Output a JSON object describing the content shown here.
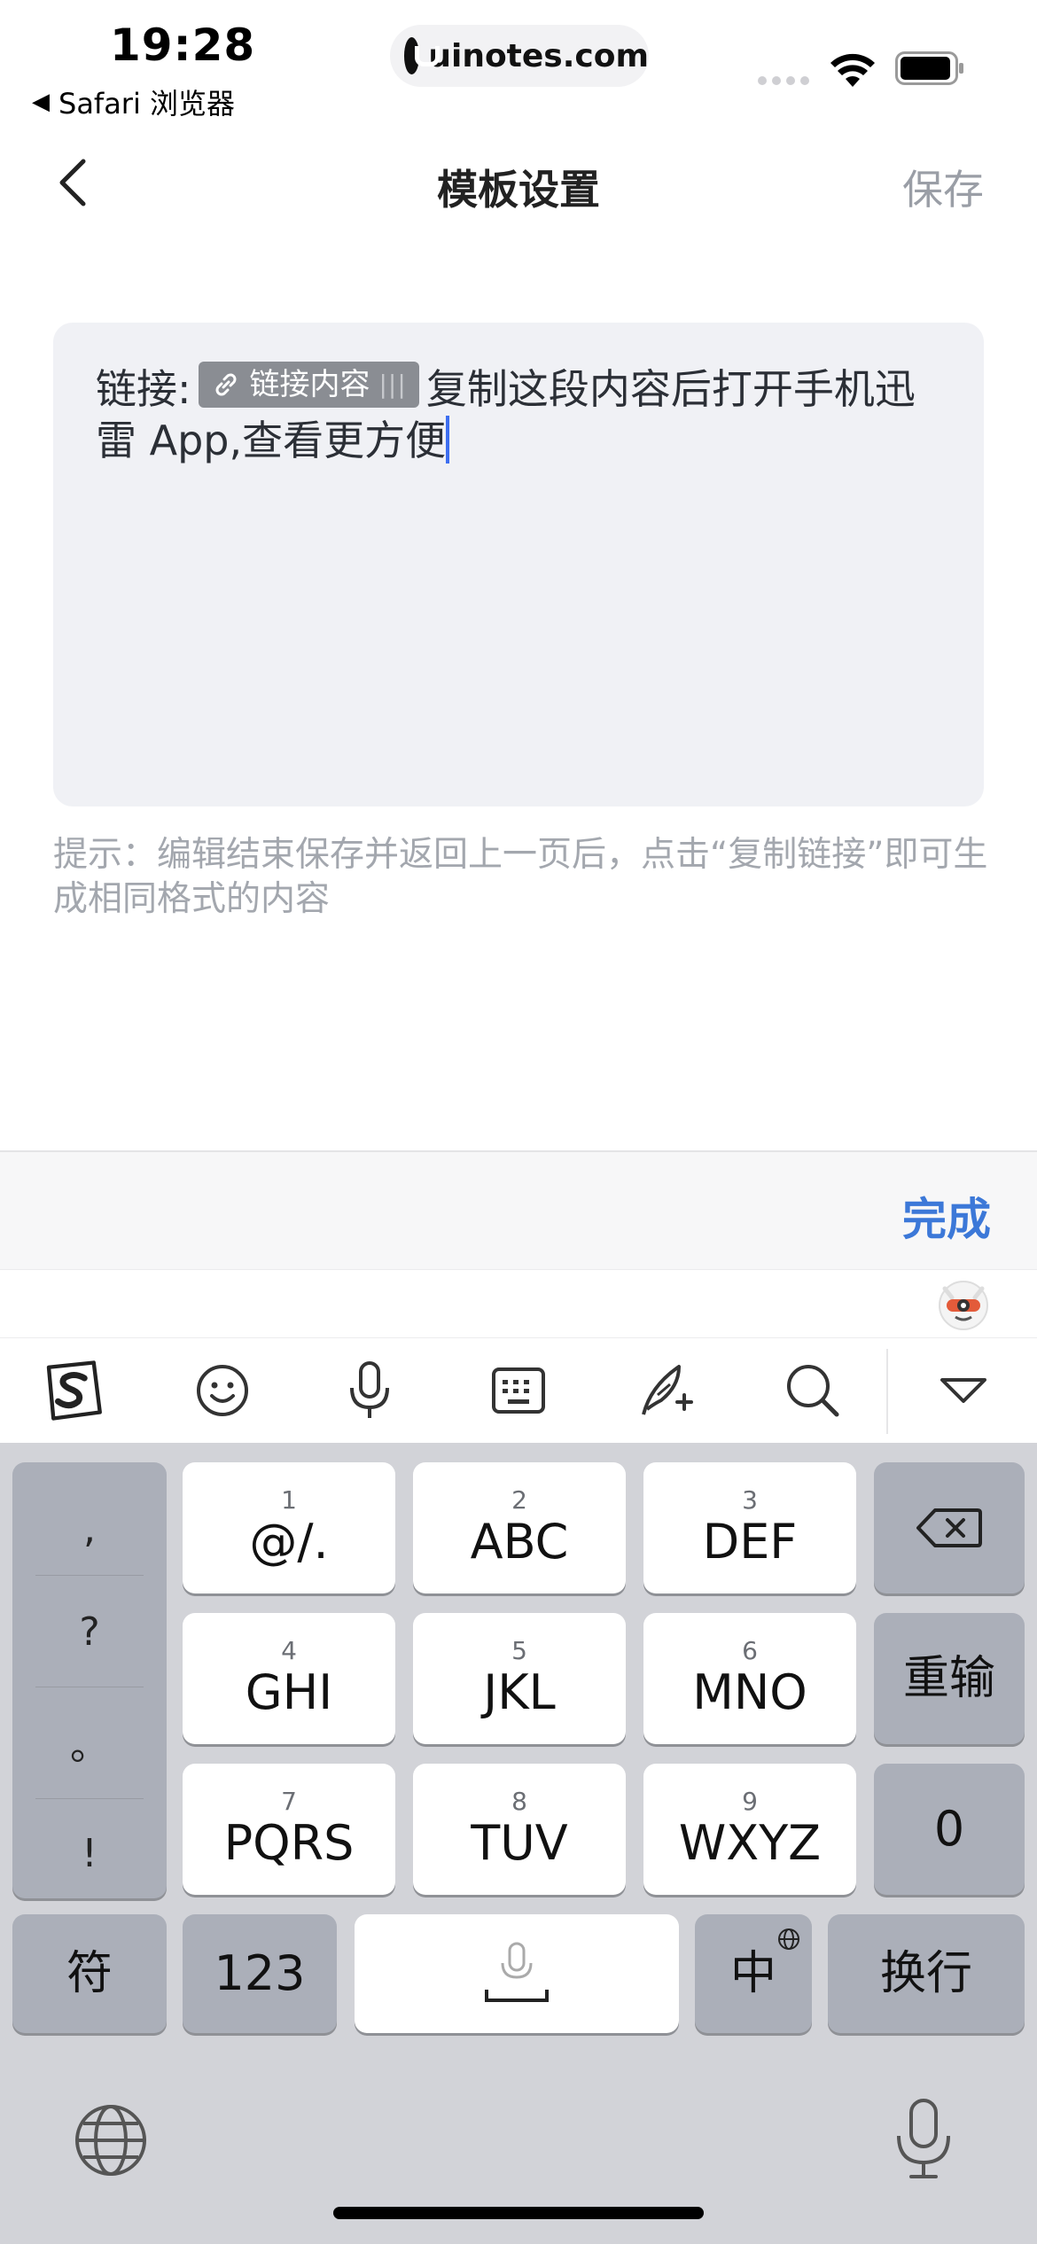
{
  "status_bar": {
    "time": "19:28",
    "back_app": "Safari 浏览器",
    "url": "uinotes.com"
  },
  "nav": {
    "title": "模板设置",
    "save_label": "保存"
  },
  "editor": {
    "prefix": "链接:",
    "chip_label": "链接内容",
    "chip_handle": "|||",
    "text": "复制这段内容后打开手机迅雷 App,查看更方便"
  },
  "hint": "提示：编辑结束保存并返回上一页后，点击“复制链接”即可生成相同格式的内容",
  "keyboard": {
    "done_label": "完成",
    "punctuation": [
      ",",
      "?",
      "。",
      "!"
    ],
    "keys": [
      {
        "num": "1",
        "label": "@/."
      },
      {
        "num": "2",
        "label": "ABC"
      },
      {
        "num": "3",
        "label": "DEF"
      },
      {
        "num": "4",
        "label": "GHI"
      },
      {
        "num": "5",
        "label": "JKL"
      },
      {
        "num": "6",
        "label": "MNO"
      },
      {
        "num": "7",
        "label": "PQRS"
      },
      {
        "num": "8",
        "label": "TUV"
      },
      {
        "num": "9",
        "label": "WXYZ"
      }
    ],
    "reinput_label": "重输",
    "zero_label": "0",
    "symbol_label": "符",
    "numbers_label": "123",
    "lang_label": "中",
    "newline_label": "换行"
  },
  "colors": {
    "accent": "#3c78d8",
    "caret": "#3d6ef0",
    "editor_bg": "#f0f1f5",
    "keyboard_bg": "#d2d3d8"
  }
}
